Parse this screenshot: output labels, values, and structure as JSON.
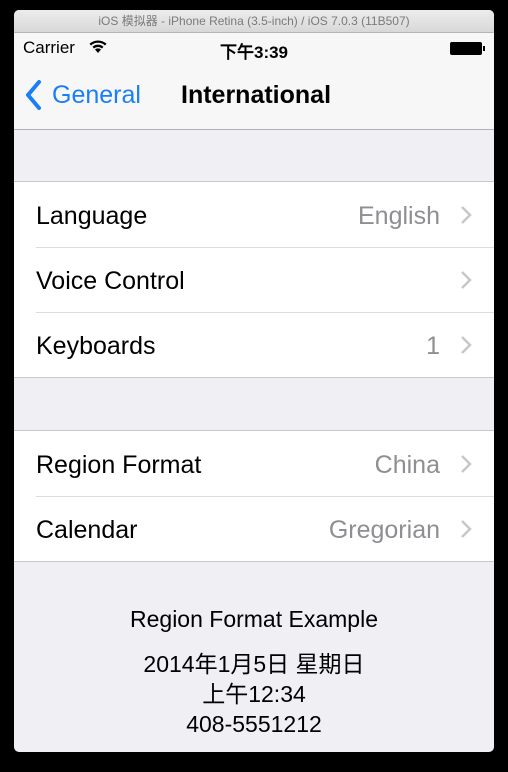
{
  "window": {
    "title": "iOS 模拟器 - iPhone Retina (3.5-inch) / iOS 7.0.3 (11B507)"
  },
  "status_bar": {
    "carrier": "Carrier",
    "wifi_icon": "wifi-icon",
    "time": "下午3:39",
    "battery_icon": "battery-icon"
  },
  "nav": {
    "back_label": "General",
    "back_icon": "chevron-left-icon",
    "title": "International",
    "accent_color": "#1a7ef4"
  },
  "groups": [
    {
      "rows": [
        {
          "label": "Language",
          "value": "English"
        },
        {
          "label": "Voice Control",
          "value": ""
        },
        {
          "label": "Keyboards",
          "value": "1"
        }
      ]
    },
    {
      "rows": [
        {
          "label": "Region Format",
          "value": "China"
        },
        {
          "label": "Calendar",
          "value": "Gregorian"
        }
      ]
    }
  ],
  "region_example": {
    "title": "Region Format Example",
    "date": "2014年1月5日 星期日",
    "time": "上午12:34",
    "phone": "408-5551212"
  }
}
